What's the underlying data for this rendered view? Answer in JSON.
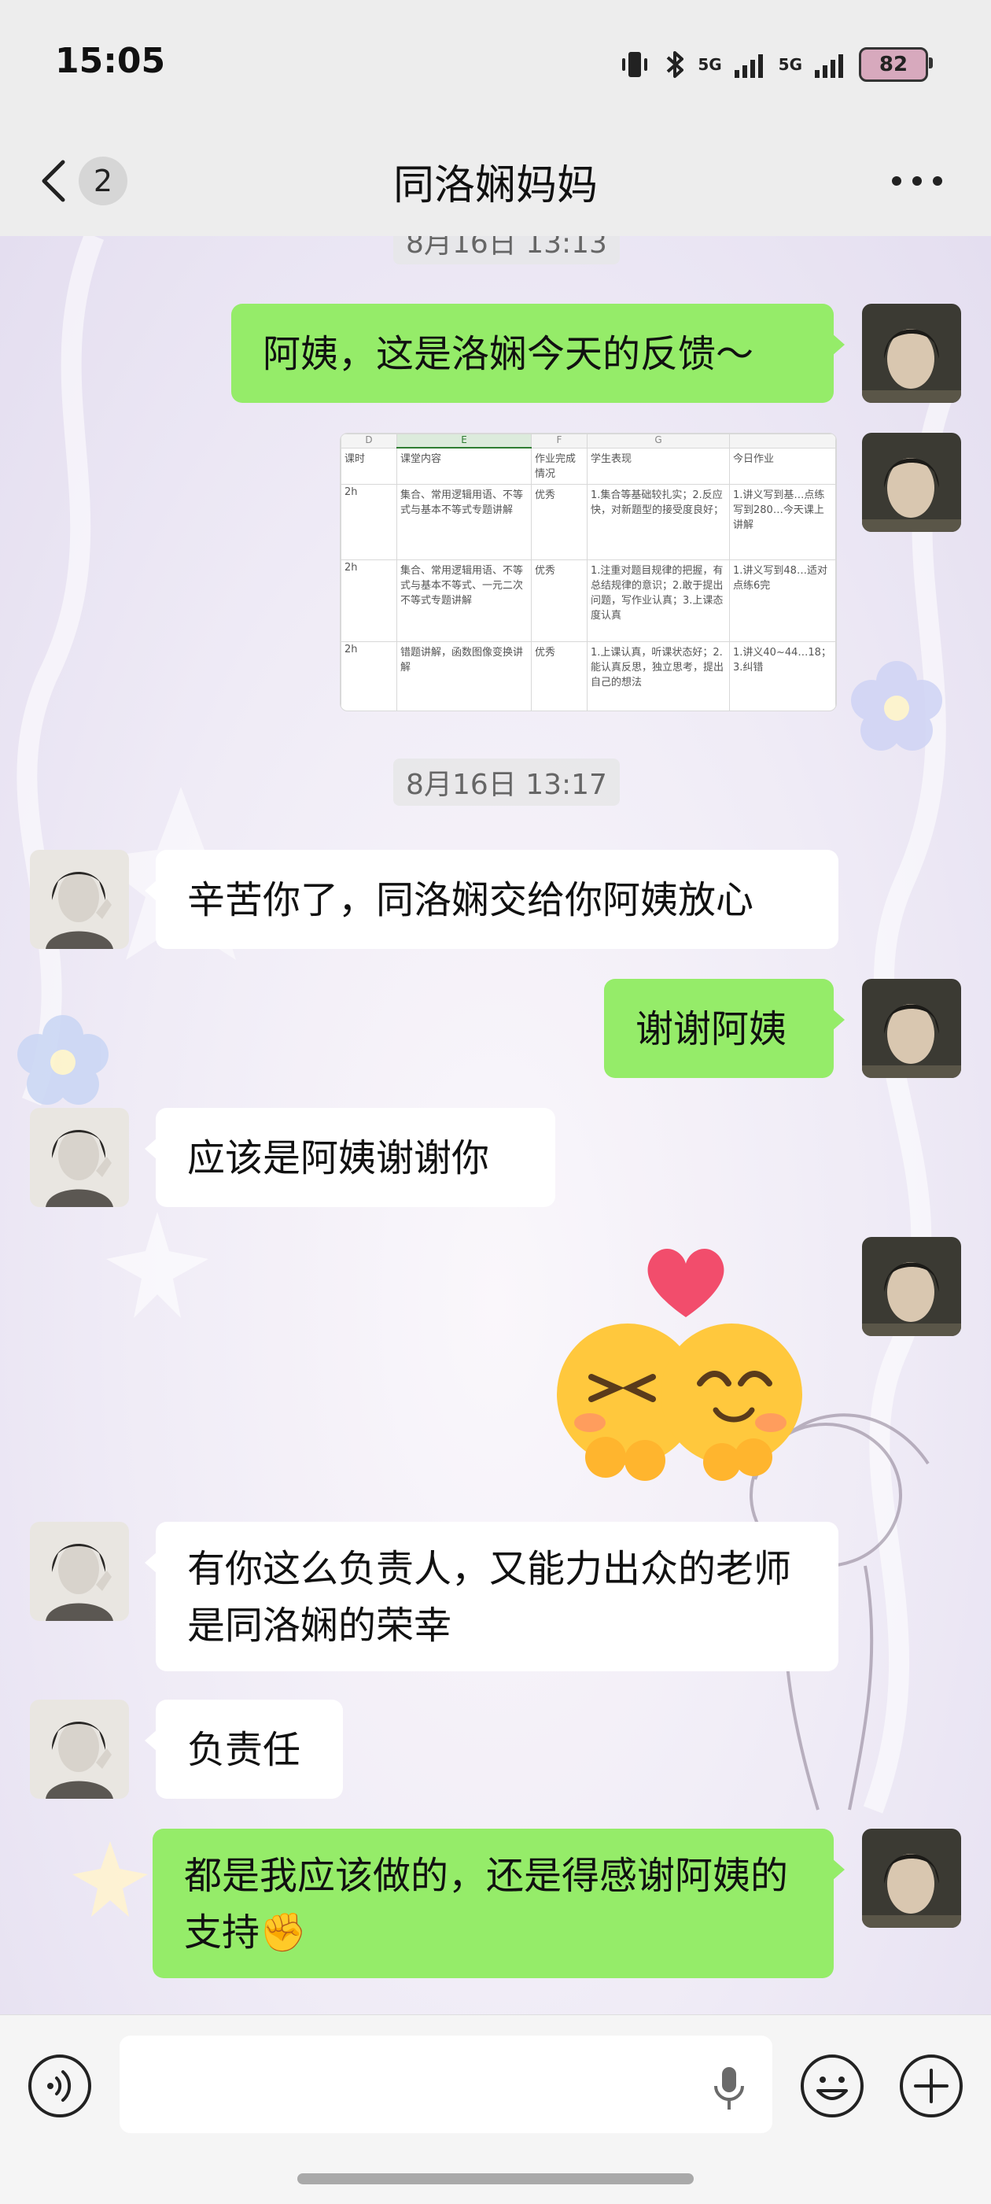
{
  "status_bar": {
    "time": "15:05",
    "network_1": "5G",
    "network_2": "5G",
    "battery": "82"
  },
  "header": {
    "unread_count": "2",
    "title": "同洛娴妈妈"
  },
  "messages": {
    "timestamp_top": "8月16日 13:13",
    "m1": "阿姨，这是洛娴今天的反馈～",
    "timestamp_2": "8月16日 13:17",
    "m2": "辛苦你了，同洛娴交给你阿姨放心",
    "m3": "谢谢阿姨",
    "m4": "应该是阿姨谢谢你",
    "m6": "有你这么负责人，又能力出众的老师是同洛娴的荣幸",
    "m7": "负责任",
    "m8": "都是我应该做的，还是得感谢阿姨的支持✊"
  },
  "spreadsheet": {
    "col_letters": [
      "D",
      "E",
      "F",
      "G",
      ""
    ],
    "headers": [
      "课时",
      "课堂内容",
      "作业完成情况",
      "学生表现",
      "今日作业"
    ],
    "rows": [
      [
        "2h",
        "集合、常用逻辑用语、不等式与基本不等式专题讲解",
        "优秀",
        "1.集合等基础较扎实；2.反应快，对新题型的接受度良好；",
        "1.讲义写到基…点练写到280…今天课上讲解"
      ],
      [
        "2h",
        "集合、常用逻辑用语、不等式与基本不等式、一元二次不等式专题讲解",
        "优秀",
        "1.注重对题目规律的把握，有总结规律的意识；2.敢于提出问题，写作业认真；3.上课态度认真",
        "1.讲义写到48…适对点练6完"
      ],
      [
        "2h",
        "错题讲解，函数图像变换讲解",
        "优秀",
        "1.上课认真，听课状态好；2.能认真反思，独立思考，提出自己的想法",
        "1.讲义40~44…18；3.纠错"
      ]
    ]
  },
  "colors": {
    "outgoing_bubble": "#95ec69",
    "incoming_bubble": "#ffffff",
    "bar_background": "#ededed"
  },
  "icons": [
    "back-chevron-icon",
    "more-dots-icon",
    "voice-icon",
    "microphone-icon",
    "emoji-icon",
    "plus-icon",
    "hug-sticker-icon"
  ]
}
